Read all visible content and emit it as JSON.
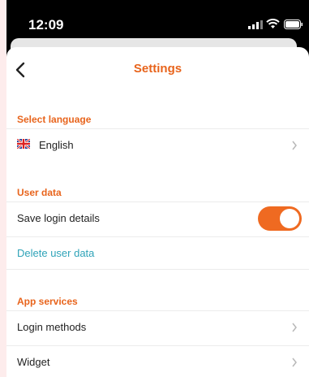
{
  "status_bar": {
    "time": "12:09"
  },
  "nav": {
    "title": "Settings"
  },
  "sections": {
    "language": {
      "header": "Select language",
      "current": "English"
    },
    "user_data": {
      "header": "User data",
      "save_login": "Save login details",
      "save_login_enabled": true,
      "delete": "Delete user data"
    },
    "app_services": {
      "header": "App services",
      "items": [
        "Login methods",
        "Widget"
      ]
    }
  },
  "colors": {
    "accent": "#e8641c",
    "toggle_on": "#ef6a21",
    "link": "#2fa3b8"
  },
  "icons": [
    "back-chevron-icon",
    "uk-flag-icon",
    "chevron-right-icon",
    "signal-icon",
    "wifi-icon",
    "battery-icon"
  ]
}
